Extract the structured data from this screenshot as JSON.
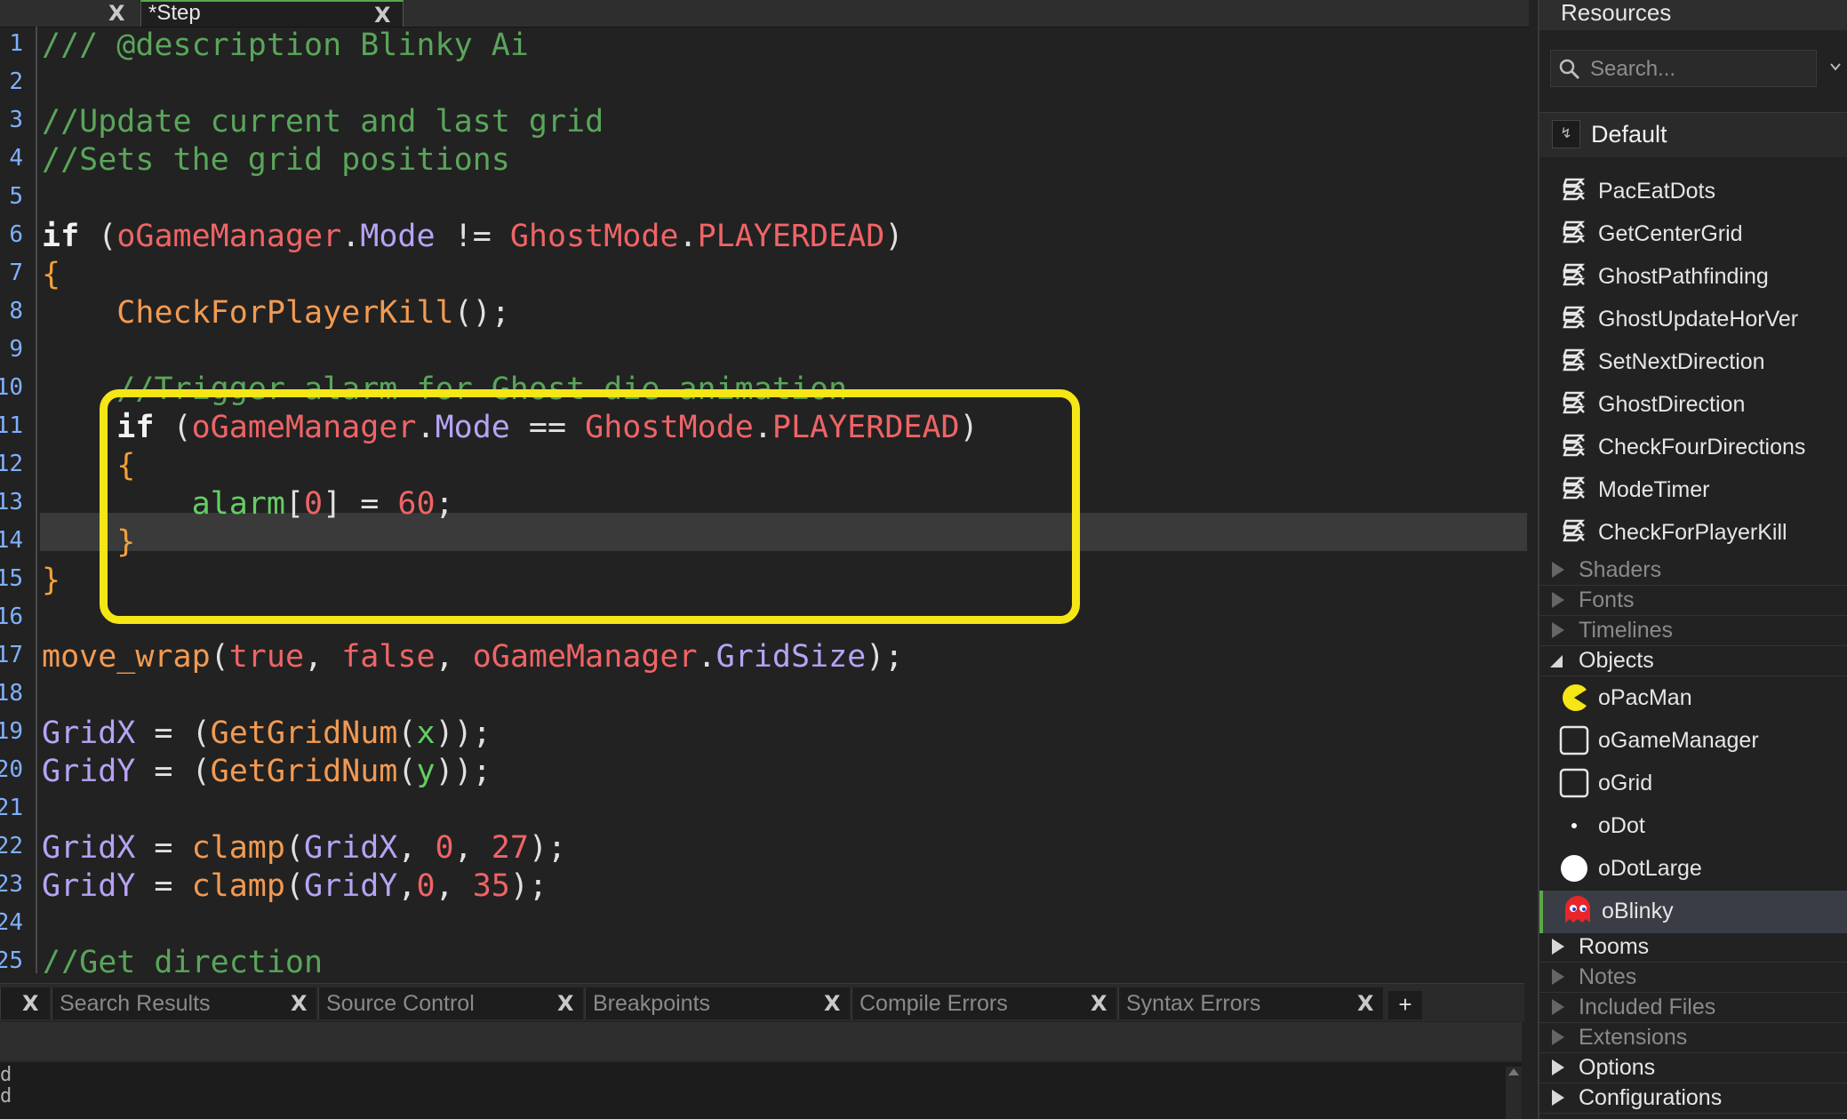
{
  "editor": {
    "tab_title": "*Step",
    "line_numbers": [
      "1",
      "2",
      "3",
      "4",
      "5",
      "6",
      "7",
      "8",
      "9",
      "10",
      "11",
      "12",
      "13",
      "14",
      "15",
      "16",
      "17",
      "18",
      "19",
      "20",
      "21",
      "22",
      "23",
      "24",
      "25"
    ],
    "code": {
      "l1": "/// @description Blinky Ai",
      "l3": "//Update current and last grid",
      "l4": "//Sets the grid positions",
      "l6_if": "if",
      "l6_p1": " (",
      "l6_obj": "oGameManager",
      "l6_dot1": ".",
      "l6_prop": "Mode",
      "l6_op": " != ",
      "l6_enum": "GhostMode",
      "l6_dot2": ".",
      "l6_val": "PLAYERDEAD",
      "l6_p2": ")",
      "l7": "{",
      "l8_fn": "CheckForPlayerKill",
      "l8_rest": "();",
      "l10": "//Trigger alarm for Ghost die animation",
      "l11_if": "if",
      "l11_p1": " (",
      "l11_obj": "oGameManager",
      "l11_dot1": ".",
      "l11_prop": "Mode",
      "l11_op": " == ",
      "l11_enum": "GhostMode",
      "l11_dot2": ".",
      "l11_val": "PLAYERDEAD",
      "l11_p2": ")",
      "l12": "{",
      "l13_var": "alarm",
      "l13_b1": "[",
      "l13_idx": "0",
      "l13_b2": "]",
      "l13_eq": " = ",
      "l13_num": "60",
      "l13_end": ";",
      "l14": "}",
      "l15": "}",
      "l17_fn": "move_wrap",
      "l17_p1": "(",
      "l17_a1": "true",
      "l17_c1": ", ",
      "l17_a2": "false",
      "l17_c2": ", ",
      "l17_obj": "oGameManager",
      "l17_dot": ".",
      "l17_prop": "GridSize",
      "l17_end": ");",
      "l19_var": "GridX",
      "l19_eq": " = (",
      "l19_fn": "GetGridNum",
      "l19_p1": "(",
      "l19_arg": "x",
      "l19_end": "));",
      "l20_var": "GridY",
      "l20_eq": " = (",
      "l20_fn": "GetGridNum",
      "l20_p1": "(",
      "l20_arg": "y",
      "l20_end": "));",
      "l22_var": "GridX",
      "l22_eq": " = ",
      "l22_fn": "clamp",
      "l22_p1": "(",
      "l22_v": "GridX",
      "l22_c1": ", ",
      "l22_n1": "0",
      "l22_c2": ", ",
      "l22_n2": "27",
      "l22_end": ");",
      "l23_var": "GridY",
      "l23_eq": " = ",
      "l23_fn": "clamp",
      "l23_p1": "(",
      "l23_v": "GridY",
      "l23_c1": ",",
      "l23_n1": "0",
      "l23_c2": ", ",
      "l23_n2": "35",
      "l23_end": ");",
      "l25": "//Get direction"
    }
  },
  "bottom_tabs": [
    {
      "label": ""
    },
    {
      "label": "Search Results"
    },
    {
      "label": "Source Control"
    },
    {
      "label": "Breakpoints"
    },
    {
      "label": "Compile Errors"
    },
    {
      "label": "Syntax Errors"
    }
  ],
  "close_glyph": "X",
  "add_tab_glyph": "+",
  "output_text": "d\nd",
  "resources": {
    "title": "Resources",
    "search_placeholder": "Search...",
    "group": "Default",
    "scripts": [
      "PacEatDots",
      "GetCenterGrid",
      "GhostPathfinding",
      "GhostUpdateHorVer",
      "SetNextDirection",
      "GhostDirection",
      "CheckFourDirections",
      "ModeTimer",
      "CheckForPlayerKill"
    ],
    "folders_a": [
      "Shaders",
      "Fonts",
      "Timelines"
    ],
    "objects_folder": "Objects",
    "objects": [
      {
        "name": "oPacMan",
        "icon": "pacman-sprite-icon"
      },
      {
        "name": "oGameManager",
        "icon": "empty-sprite-icon"
      },
      {
        "name": "oGrid",
        "icon": "empty-sprite-icon"
      },
      {
        "name": "oDot",
        "icon": "dot-sprite-icon"
      },
      {
        "name": "oDotLarge",
        "icon": "large-dot-sprite-icon"
      },
      {
        "name": "oBlinky",
        "icon": "blinky-ghost-icon",
        "selected": true
      }
    ],
    "folders_b": [
      "Rooms",
      "Notes",
      "Included Files",
      "Extensions",
      "Options",
      "Configurations"
    ]
  },
  "colors": {
    "comment": "#5aa55a",
    "highlight_box": "#f5e616",
    "selection_accent": "#58a94a"
  }
}
